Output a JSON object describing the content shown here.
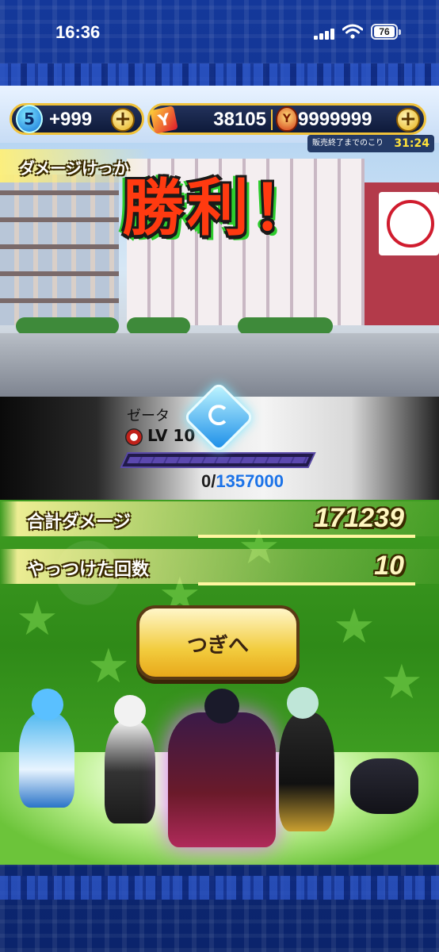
{
  "status_bar": {
    "time": "16:36",
    "battery": "76"
  },
  "currency": {
    "orb_level": "5",
    "orb_count": "+999",
    "ymoney": "38105",
    "medals": "9999999",
    "sale_label": "販売終了までのこり",
    "sale_timer": "31:24"
  },
  "section_title": "ダメージけっか",
  "victory": "勝利！",
  "character": {
    "name": "ゼータ",
    "level": "LV 10",
    "exp_current": "0/",
    "exp_max": "1357000",
    "exp_fill": 0
  },
  "results": {
    "total_damage_label": "合計ダメージ",
    "total_damage": "171239",
    "defeats_label": "やっつけた回数",
    "defeats": "10"
  },
  "next_button": "つぎへ",
  "colors": {
    "accent": "#f2cc3e",
    "frame": "#14389a",
    "field": "#3f9d22",
    "exp_max": "#1c73e8"
  }
}
